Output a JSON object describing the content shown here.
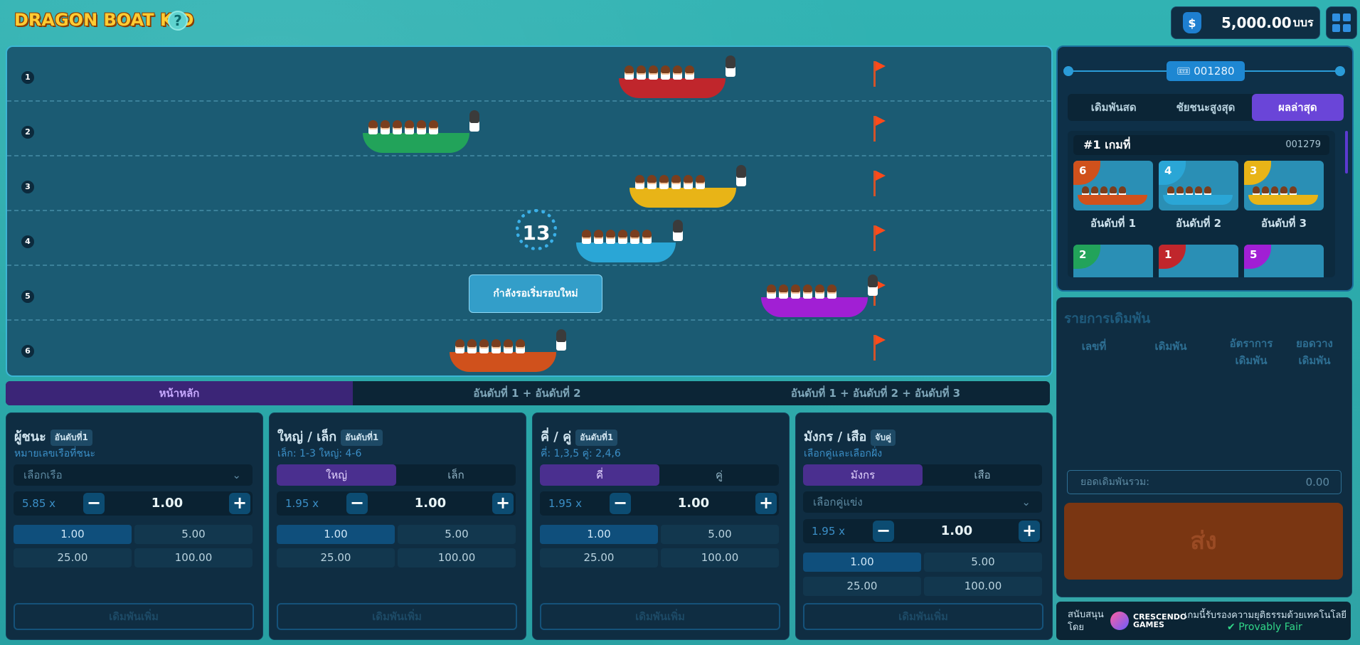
{
  "header": {
    "logo": "DRAGON BOAT KID",
    "help": "?",
    "balance": "5,000.00",
    "currency": "บบร",
    "balance_icon": "$"
  },
  "race": {
    "lanes": [
      "1",
      "2",
      "3",
      "4",
      "5",
      "6"
    ],
    "countdown": "13",
    "waiting_text": "กำลังรอเริ่มรอบใหม่"
  },
  "bet_tabs": [
    "หน้าหลัก",
    "อันดับที่ 1 + อันดับที่ 2",
    "อันดับที่ 1 + อันดับที่ 2 + อันดับที่ 3"
  ],
  "panels": [
    {
      "title": "ผู้ชนะ",
      "badge": "อันดับที่1",
      "sub": "หมายเลขเรือที่ชนะ",
      "select": "เลือกเรือ",
      "odds": "5.85 x",
      "amount": "1.00",
      "chips": [
        "1.00",
        "5.00",
        "25.00",
        "100.00"
      ],
      "place": "เดิมพันเพิ่ม"
    },
    {
      "title": "ใหญ่ / เล็ก",
      "badge": "อันดับที่1",
      "sub": "เล็ก: 1-3     ใหญ่: 4-6",
      "toggle": [
        "ใหญ่",
        "เล็ก"
      ],
      "odds": "1.95 x",
      "amount": "1.00",
      "chips": [
        "1.00",
        "5.00",
        "25.00",
        "100.00"
      ],
      "place": "เดิมพันเพิ่ม"
    },
    {
      "title": "คี่ / คู่",
      "badge": "อันดับที่1",
      "sub": "คี่: 1,3,5     คู่: 2,4,6",
      "toggle": [
        "คี่",
        "คู่"
      ],
      "odds": "1.95 x",
      "amount": "1.00",
      "chips": [
        "1.00",
        "5.00",
        "25.00",
        "100.00"
      ],
      "place": "เดิมพันเพิ่ม"
    },
    {
      "title": "มังกร / เสือ",
      "badge": "จับคู่",
      "sub": "เลือกคู่และเลือกฝั่ง",
      "toggle": [
        "มังกร",
        "เสือ"
      ],
      "select": "เลือกคู่แข่ง",
      "odds": "1.95 x",
      "amount": "1.00",
      "chips": [
        "1.00",
        "5.00",
        "25.00",
        "100.00"
      ],
      "place": "เดิมพันเพิ่ม"
    }
  ],
  "results": {
    "round": "001280",
    "tabs": [
      "เดิมพันสด",
      "ชัยชนะสูงสุด",
      "ผลล่าสุด"
    ],
    "game_label": "#1  เกมที่",
    "game_id": "001279",
    "places": [
      "อันดับที่ 1",
      "อันดับที่ 2",
      "อันดับที่ 3"
    ],
    "top_cards": [
      "6",
      "4",
      "3"
    ],
    "bottom_cards": [
      "2",
      "1",
      "5"
    ]
  },
  "betslip": {
    "title": "รายการเดิมพัน",
    "cols": [
      "เลขที่",
      "เดิมพัน",
      "อัตราการ\nเดิมพัน",
      "ยอดวาง\nเดิมพัน"
    ],
    "total_label": "ยอดเดิมพันรวม:",
    "total_value": "0.00",
    "send": "ส่ง"
  },
  "footer": {
    "support": "สนับสนุนโดย",
    "brand": "CRESCENDO GAMES",
    "cert": "เกมนี้รับรองความยุติธรรมด้วยเทคโนโลยี",
    "fair": "Provably Fair"
  },
  "colors": {
    "boat1": "#c0262c",
    "boat2": "#22a35a",
    "boat3": "#e8b417",
    "boat4": "#2aa6d6",
    "boat5": "#a11fd4",
    "boat6": "#d0511c",
    "accent": "#6a45d8"
  }
}
